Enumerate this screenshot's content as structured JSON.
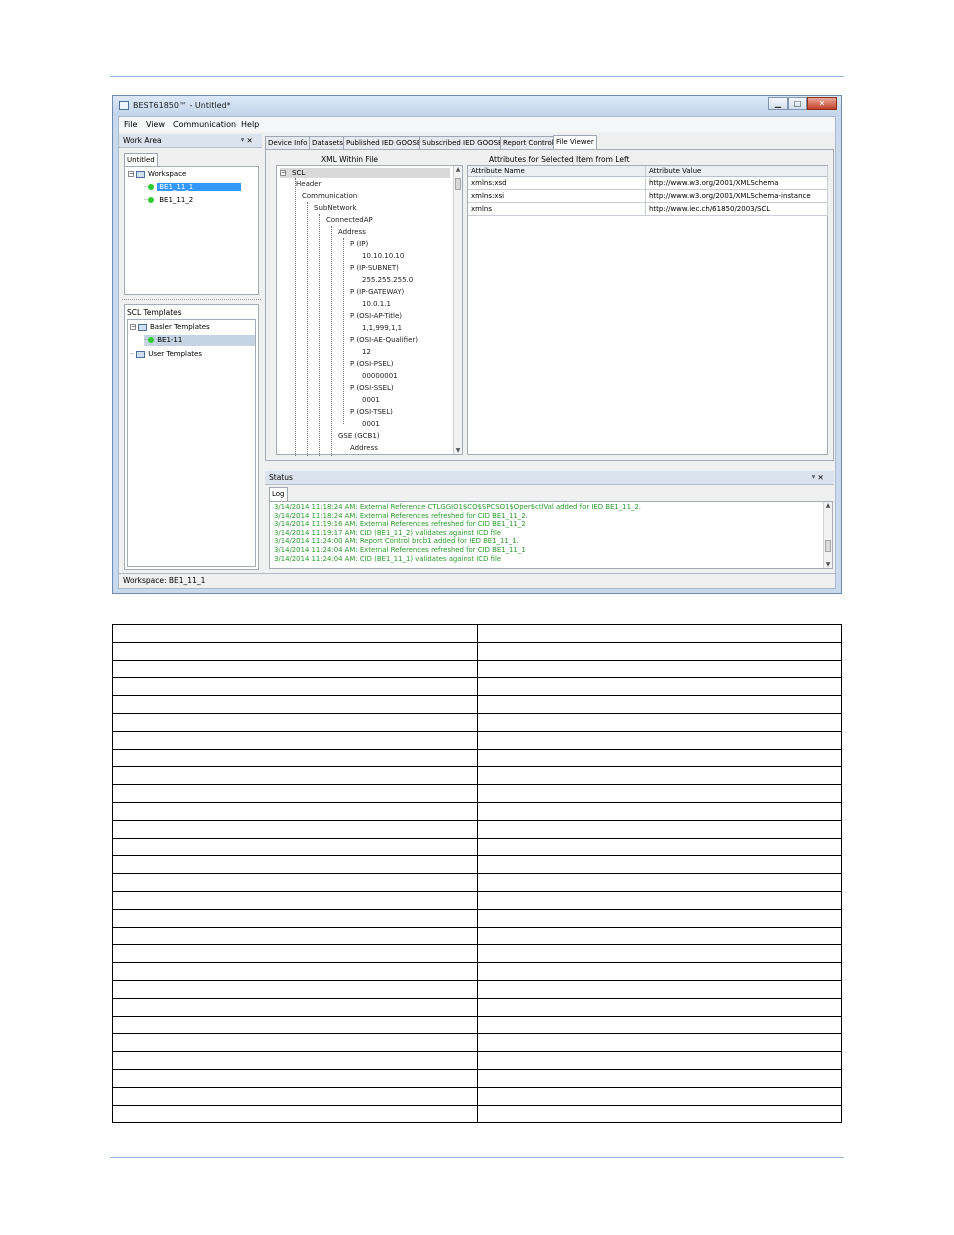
{
  "window": {
    "title": "BEST61850™ - Untitled*",
    "controls": {
      "minimize": "▁",
      "maximize": "□",
      "close": "✕"
    },
    "menu": [
      "File",
      "View",
      "Communication",
      "Help"
    ]
  },
  "work_area": {
    "title": "Work Area",
    "pin": "ᵠ ✕",
    "tab": "Untitled",
    "tree": {
      "root": "Workspace",
      "items": [
        "BE1_11_1",
        "BE1_11_2"
      ]
    },
    "scl_templates": {
      "title": "SCL Templates",
      "basler": "Basler Templates",
      "basler_child": "BE1-11",
      "user": "User Templates"
    }
  },
  "tabs": [
    "Device Info",
    "Datasets",
    "Published IED GOOSE",
    "Subscribed IED GOOSE",
    "Report Controls",
    "File Viewer"
  ],
  "file_viewer": {
    "xml_header": "XML Within File",
    "attr_header": "Attributes for Selected Item from Left",
    "xml_nodes": [
      "SCL",
      "Header",
      "Communication",
      "SubNetwork",
      "ConnectedAP",
      "Address",
      "P (IP)",
      "10.10.10.10",
      "P (IP-SUBNET)",
      "255.255.255.0",
      "P (IP-GATEWAY)",
      "10.0.1.1",
      "P (OSI-AP-Title)",
      "1,1,999,1,1",
      "P (OSI-AE-Qualifier)",
      "12",
      "P (OSI-PSEL)",
      "00000001",
      "P (OSI-SSEL)",
      "0001",
      "P (OSI-TSEL)",
      "0001",
      "GSE (GCB1)",
      "Address"
    ],
    "columns": [
      "Attribute Name",
      "Attribute Value"
    ],
    "rows": [
      [
        "xmlns:xsd",
        "http://www.w3.org/2001/XMLSchema"
      ],
      [
        "xmlns:xsi",
        "http://www.w3.org/2001/XMLSchema-instance"
      ],
      [
        "xmlns",
        "http://www.iec.ch/61850/2003/SCL"
      ]
    ]
  },
  "status_panel": {
    "title": "Status",
    "tab": "Log",
    "log": [
      "3/14/2014 11:18:24 AM: External Reference CTLGGIO1$CO$SPCSO1$Oper$ctlVal added for IED BE1_11_2.",
      "3/14/2014 11:18:24 AM: External References refreshed for CID BE1_11_2.",
      "3/14/2014 11:19:16 AM: External References refreshed for CID BE1_11_2",
      "3/14/2014 11:19:17 AM: CID (BE1_11_2) validates against ICD file",
      "3/14/2014 11:24:00 AM: Report Control brcb1 added for IED BE1_11_1.",
      "3/14/2014 11:24:04 AM: External References refreshed for CID BE1_11_1",
      "3/14/2014 11:24:04 AM: CID (BE1_11_1) validates against ICD file"
    ]
  },
  "status_bar": "Workspace: BE1_11_1",
  "colors": {
    "selection": "#3399ff",
    "log_text": "#2a9c2a",
    "status_dot": "#2fcc2f",
    "rule": "#8fb3d9"
  }
}
